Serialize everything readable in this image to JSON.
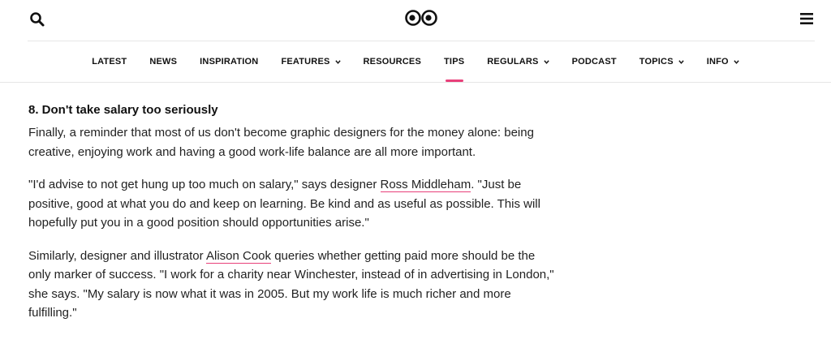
{
  "header": {
    "search_icon": "search-icon",
    "logo_icon": "eyes-logo-icon",
    "menu_icon": "hamburger-menu-icon"
  },
  "nav": {
    "items": [
      {
        "label": "LATEST",
        "dropdown": false,
        "active": false
      },
      {
        "label": "NEWS",
        "dropdown": false,
        "active": false
      },
      {
        "label": "INSPIRATION",
        "dropdown": false,
        "active": false
      },
      {
        "label": "FEATURES",
        "dropdown": true,
        "active": false
      },
      {
        "label": "RESOURCES",
        "dropdown": false,
        "active": false
      },
      {
        "label": "TIPS",
        "dropdown": false,
        "active": true
      },
      {
        "label": "REGULARS",
        "dropdown": true,
        "active": false
      },
      {
        "label": "PODCAST",
        "dropdown": false,
        "active": false
      },
      {
        "label": "TOPICS",
        "dropdown": true,
        "active": false
      },
      {
        "label": "INFO",
        "dropdown": true,
        "active": false
      }
    ],
    "accent_color": "#e8407a"
  },
  "article": {
    "heading": "8. Don't take salary too seriously",
    "p1": "Finally, a reminder that most of us don't become graphic designers for the money alone: being creative, enjoying work and having a good work-life balance are all more important.",
    "p2_before": "\"I'd advise to not get hung up too much on salary,\" says designer ",
    "p2_link": "Ross Middleham",
    "p2_after": ". \"Just be positive, good at what you do and keep on learning. Be kind and as useful as possible. This will hopefully put you in a good position should opportunities arise.\"",
    "p3_before": "Similarly, designer and illustrator ",
    "p3_link": "Alison Cook",
    "p3_after": " queries whether getting paid more should be the only marker of success. \"I work for a charity near Winchester, instead of in advertising in London,\" she says. \"My salary is now what it was in 2005. But my work life is much richer and more fulfilling.\""
  }
}
